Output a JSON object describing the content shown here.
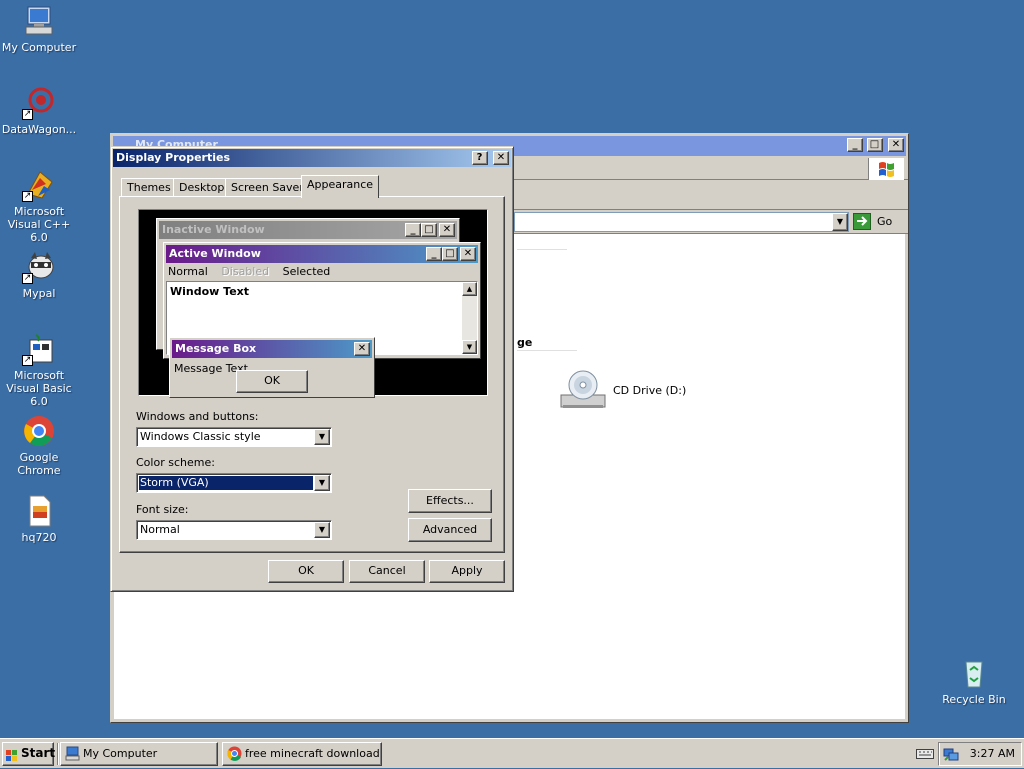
{
  "desktop": {
    "icons": [
      {
        "label": "My Computer",
        "icon": "my-computer-icon"
      },
      {
        "label": "DataWagon...",
        "icon": "datawagon-icon"
      },
      {
        "label": "Microsoft Visual C++ 6.0",
        "icon": "visual-cpp-icon"
      },
      {
        "label": "Mypal",
        "icon": "mypal-icon"
      },
      {
        "label": "Microsoft Visual Basic 6.0",
        "icon": "visual-basic-icon"
      },
      {
        "label": "Google Chrome",
        "icon": "chrome-icon"
      },
      {
        "label": "hq720",
        "icon": "image-file-icon"
      }
    ],
    "recycle_bin": {
      "label": "Recycle Bin",
      "icon": "recycle-bin-icon"
    },
    "background_color": "#3a6ea5"
  },
  "mycomputer": {
    "title": "My Computer",
    "go_label": "Go",
    "section_header_partial": "ge",
    "cd_drive_label": "CD Drive (D:)"
  },
  "dialog": {
    "title": "Display Properties",
    "tabs": [
      "Themes",
      "Desktop",
      "Screen Saver",
      "Appearance"
    ],
    "active_tab": "Appearance",
    "preview": {
      "inactive_title": "Inactive Window",
      "active_title": "Active Window",
      "menu": {
        "normal": "Normal",
        "disabled": "Disabled",
        "selected": "Selected"
      },
      "window_text": "Window Text",
      "message_title": "Message Box",
      "message_text": "Message Text",
      "ok": "OK"
    },
    "windows_buttons_label": "Windows and buttons:",
    "windows_buttons_value": "Windows Classic style",
    "color_scheme_label": "Color scheme:",
    "color_scheme_value": "Storm (VGA)",
    "font_size_label": "Font size:",
    "font_size_value": "Normal",
    "effects_label": "Effects...",
    "advanced_label": "Advanced",
    "ok_label": "OK",
    "cancel_label": "Cancel",
    "apply_label": "Apply",
    "colors": {
      "title_start": "#0a246a",
      "title_end": "#a6caf0",
      "storm_start": "#6a1a8a",
      "storm_end": "#4c9ac8"
    }
  },
  "taskbar": {
    "start_label": "Start",
    "tasks": [
      {
        "label": "My Computer",
        "icon": "my-computer-icon"
      },
      {
        "label": "free minecraft download ...",
        "icon": "chrome-icon"
      }
    ],
    "clock": "3:27 AM"
  }
}
